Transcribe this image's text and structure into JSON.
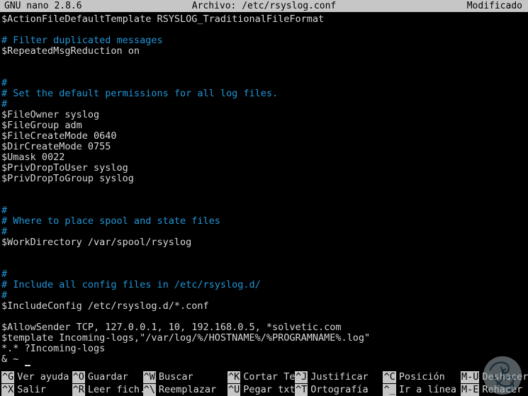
{
  "titlebar": {
    "app": "GNU nano 2.8.6",
    "file_label": "Archivo: /etc/rsyslog.conf",
    "status": "Modificado"
  },
  "editor": {
    "lines": [
      {
        "text": "$ActionFileDefaultTemplate RSYSLOG_TraditionalFileFormat",
        "kind": "text"
      },
      {
        "text": "",
        "kind": "blank"
      },
      {
        "text": "# Filter duplicated messages",
        "kind": "comment"
      },
      {
        "text": "$RepeatedMsgReduction on",
        "kind": "text"
      },
      {
        "text": "",
        "kind": "blank"
      },
      {
        "text": "",
        "kind": "blank"
      },
      {
        "text": "#",
        "kind": "comment"
      },
      {
        "text": "# Set the default permissions for all log files.",
        "kind": "comment"
      },
      {
        "text": "#",
        "kind": "comment"
      },
      {
        "text": "$FileOwner syslog",
        "kind": "text"
      },
      {
        "text": "$FileGroup adm",
        "kind": "text"
      },
      {
        "text": "$FileCreateMode 0640",
        "kind": "text"
      },
      {
        "text": "$DirCreateMode 0755",
        "kind": "text"
      },
      {
        "text": "$Umask 0022",
        "kind": "text"
      },
      {
        "text": "$PrivDropToUser syslog",
        "kind": "text"
      },
      {
        "text": "$PrivDropToGroup syslog",
        "kind": "text"
      },
      {
        "text": "",
        "kind": "blank"
      },
      {
        "text": "",
        "kind": "blank"
      },
      {
        "text": "#",
        "kind": "comment"
      },
      {
        "text": "# Where to place spool and state files",
        "kind": "comment"
      },
      {
        "text": "#",
        "kind": "comment"
      },
      {
        "text": "$WorkDirectory /var/spool/rsyslog",
        "kind": "text"
      },
      {
        "text": "",
        "kind": "blank"
      },
      {
        "text": "",
        "kind": "blank"
      },
      {
        "text": "#",
        "kind": "comment"
      },
      {
        "text": "# Include all config files in /etc/rsyslog.d/",
        "kind": "comment"
      },
      {
        "text": "#",
        "kind": "comment"
      },
      {
        "text": "$IncludeConfig /etc/rsyslog.d/*.conf",
        "kind": "text"
      },
      {
        "text": "",
        "kind": "blank"
      },
      {
        "text": "$AllowSender TCP, 127.0.0.1, 10, 192.168.0.5, *solvetic.com",
        "kind": "text"
      },
      {
        "text": "$template Incoming-logs,\"/var/log/%/HOSTNAME%/%PROGRAMNAME%.log\"",
        "kind": "text"
      },
      {
        "text": "*.* ?Incoming-logs",
        "kind": "text"
      },
      {
        "text": "& ~",
        "kind": "text"
      }
    ]
  },
  "footer": {
    "columns": [
      {
        "top": {
          "key": "^G",
          "label": "Ver ayuda"
        },
        "bottom": {
          "key": "^X",
          "label": "Salir"
        }
      },
      {
        "top": {
          "key": "^O",
          "label": "Guardar"
        },
        "bottom": {
          "key": "^R",
          "label": "Leer fich."
        }
      },
      {
        "top": {
          "key": "^W",
          "label": "Buscar"
        },
        "bottom": {
          "key": "^\\",
          "label": "Reemplazar"
        }
      },
      {
        "top": {
          "key": "^K",
          "label": "Cortar Text"
        },
        "bottom": {
          "key": "^U",
          "label": "Pegar txt"
        }
      },
      {
        "top": {
          "key": "^J",
          "label": "Justificar"
        },
        "bottom": {
          "key": "^T",
          "label": "Ortografía"
        }
      },
      {
        "top": {
          "key": "^C",
          "label": "Posición"
        },
        "bottom": {
          "key": "^_",
          "label": "Ir a línea"
        }
      },
      {
        "top": {
          "key": "M-U",
          "label": "Deshacer"
        },
        "bottom": {
          "key": "M-E",
          "label": "Rehacer"
        }
      }
    ]
  },
  "colors": {
    "background": "#000000",
    "foreground": "#d8d8d8",
    "comment": "#2196d8",
    "bar_background": "#c6c6c6",
    "bar_foreground": "#000000"
  }
}
